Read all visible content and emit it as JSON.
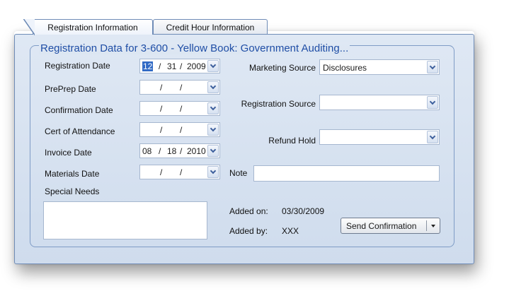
{
  "tabs": [
    {
      "label": "Registration Information",
      "active": true
    },
    {
      "label": "Credit Hour Information",
      "active": false
    }
  ],
  "group_title": "Registration Data for 3-600 - Yellow Book: Government Auditing...",
  "left_fields": {
    "registration_date": {
      "label": "Registration Date",
      "month": "12",
      "day": "31",
      "year": "2009"
    },
    "preprep_date": {
      "label": "PrePrep Date",
      "month": "",
      "day": "",
      "year": ""
    },
    "confirmation_date": {
      "label": "Confirmation Date",
      "month": "",
      "day": "",
      "year": ""
    },
    "cert_of_attendance": {
      "label": "Cert of Attendance",
      "month": "",
      "day": "",
      "year": ""
    },
    "invoice_date": {
      "label": "Invoice Date",
      "month": "08",
      "day": "18",
      "year": "2010"
    },
    "materials_date": {
      "label": "Materials Date",
      "month": "",
      "day": "",
      "year": ""
    }
  },
  "date_separator": "/",
  "special_needs": {
    "label": "Special Needs",
    "value": ""
  },
  "right_fields": {
    "marketing_source": {
      "label": "Marketing Source",
      "value": "Disclosures"
    },
    "registration_source": {
      "label": "Registration Source",
      "value": ""
    },
    "refund_hold": {
      "label": "Refund Hold",
      "value": ""
    },
    "note": {
      "label": "Note",
      "value": ""
    }
  },
  "added_on": {
    "label": "Added on:",
    "value": "03/30/2009"
  },
  "added_by": {
    "label": "Added by:",
    "value": "XXX"
  },
  "send_confirmation_label": "Send Confirmation",
  "colors": {
    "panel_bg": "#dfe8f4",
    "border": "#6f8cb7",
    "group_title": "#1f4ea6",
    "highlight": "#316ac5"
  }
}
